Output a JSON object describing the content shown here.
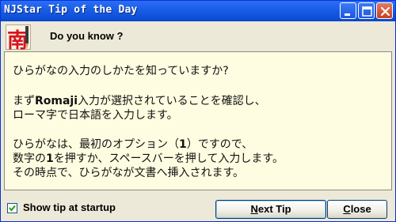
{
  "window": {
    "title": "NJStar Tip of the Day"
  },
  "header": {
    "heading": "Do you know ?",
    "app_icon": "nan-pencil-icon",
    "app_icon_glyph": "南"
  },
  "tip": {
    "p1": "ひらがなの入力のしかたを知っていますか?",
    "p2_line1_a": "まず",
    "p2_line1_b": "Romaji",
    "p2_line1_c": "入力が選択されていることを確認し、",
    "p2_line2": "ローマ字で日本語を入力します。",
    "p3_line1_a": "ひらがなは、最初のオプション（",
    "p3_line1_b": "1",
    "p3_line1_c": "）ですので、",
    "p3_line2_a": "数字の",
    "p3_line2_b": "1",
    "p3_line2_c": "を押すか、スペースバーを押して入力します。",
    "p3_line3": "その時点で、ひらがなが文書へ挿入されます。"
  },
  "footer": {
    "show_tip_label": "Show tip at startup",
    "show_tip_checked": true,
    "next_button": {
      "mnemonic": "N",
      "rest": "ext Tip"
    },
    "close_button": {
      "mnemonic": "C",
      "rest": "lose"
    }
  },
  "colors": {
    "titlebar": "#0c4fd8",
    "content_bg": "#fffde1",
    "icon_red": "#d8141d"
  }
}
